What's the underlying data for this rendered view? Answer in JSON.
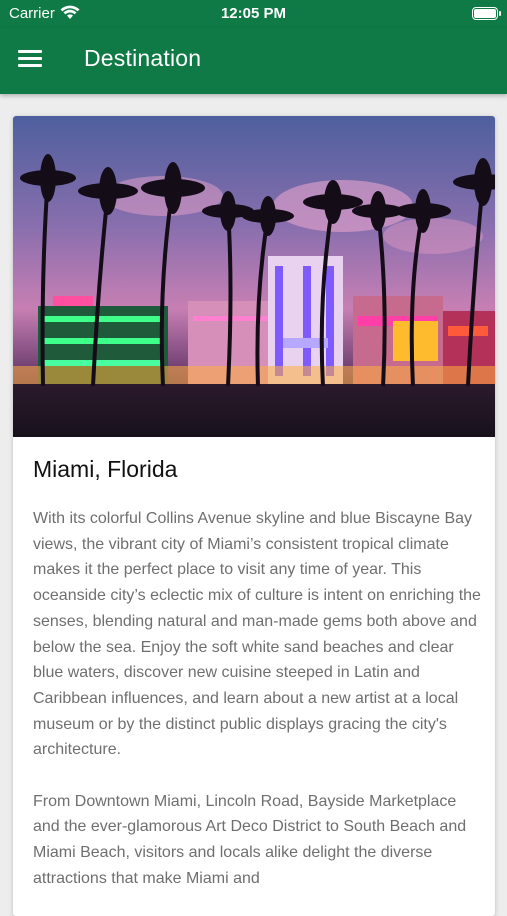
{
  "status_bar": {
    "carrier": "Carrier",
    "time": "12:05 PM",
    "battery_level": 1.0
  },
  "app_bar": {
    "title": "Destination",
    "menu_icon": "hamburger-menu-icon",
    "color": "#0f7a45"
  },
  "destination": {
    "name": "Miami, Florida",
    "paragraphs": [
      "With its colorful Collins Avenue skyline and blue Biscayne Bay views, the vibrant city of Miami’s consistent tropical climate makes it the perfect place to visit any time of year. This oceanside city’s eclectic mix of culture is intent on enriching the senses, blending natural and man-made gems both above and below the sea. Enjoy the soft white sand beaches and clear blue waters, discover new cuisine steeped in Latin and Caribbean influences, and learn about a new artist at a local museum or by the distinct public displays gracing the city's architecture.",
      "From Downtown Miami, Lincoln Road, Bayside Marketplace and the ever-glamorous Art Deco District to South Beach and Miami Beach, visitors and locals alike delight the diverse attractions that make Miami and"
    ]
  }
}
